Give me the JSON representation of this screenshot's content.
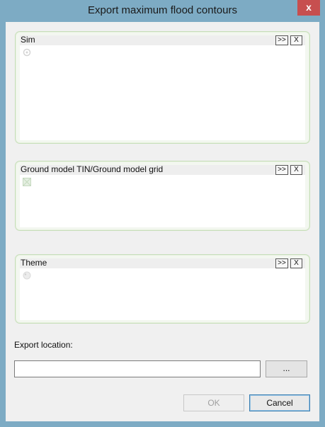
{
  "window": {
    "title": "Export maximum flood contours",
    "close_label": "x"
  },
  "groups": [
    {
      "label": "Sim",
      "expand_label": ">>",
      "clear_label": "X",
      "icon": "sim-icon"
    },
    {
      "label": "Ground model TIN/Ground model grid",
      "expand_label": ">>",
      "clear_label": "X",
      "icon": "ground-model-icon"
    },
    {
      "label": "Theme",
      "expand_label": ">>",
      "clear_label": "X",
      "icon": "theme-icon"
    }
  ],
  "export": {
    "label": "Export location:",
    "value": "",
    "browse_label": "..."
  },
  "buttons": {
    "ok_label": "OK",
    "ok_enabled": false,
    "cancel_label": "Cancel"
  }
}
